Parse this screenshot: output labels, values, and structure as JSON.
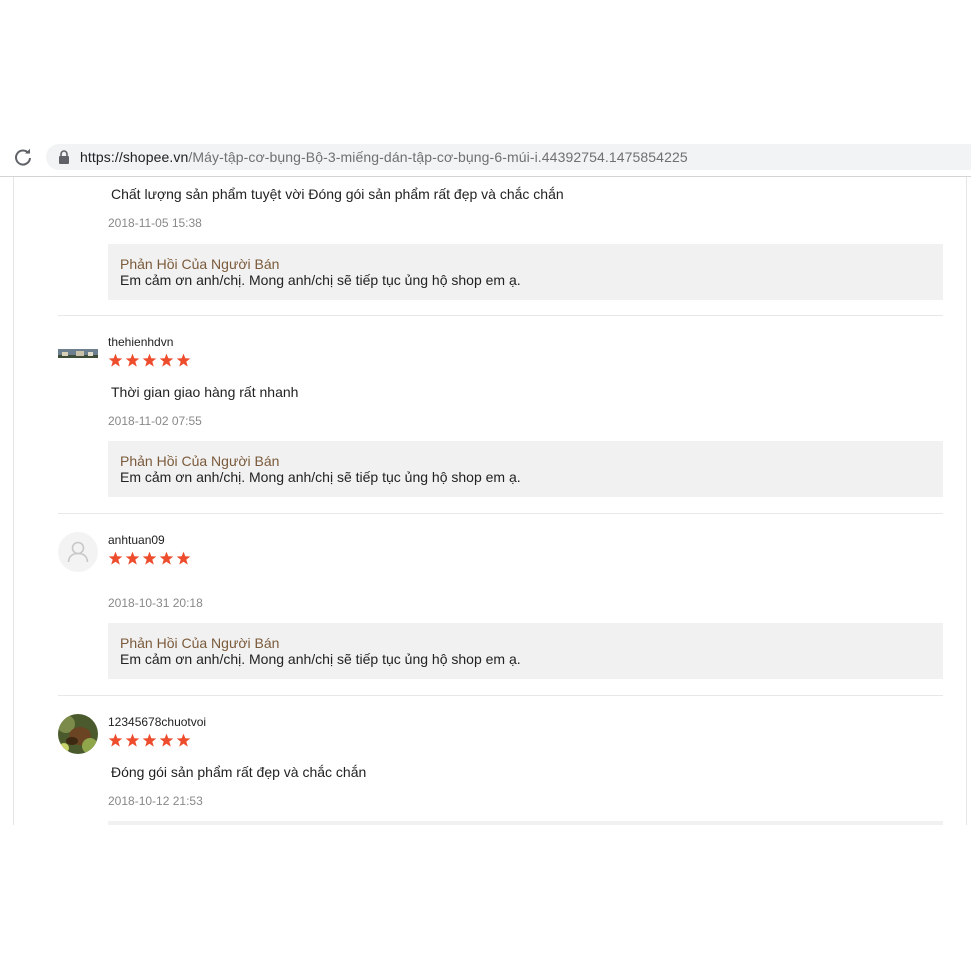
{
  "browser": {
    "url_host": "https://shopee.vn",
    "url_path": "/Máy-tập-cơ-bụng-Bộ-3-miếng-dán-tập-cơ-bụng-6-múi-i.44392754.1475854225"
  },
  "reviews": [
    {
      "comment": "Chất lượng sản phẩm tuyệt vời Đóng gói sản phẩm rất đẹp và chắc chắn",
      "time": "2018-11-05 15:38",
      "reply_title": "Phản Hồi Của Người Bán",
      "reply_text": "Em cảm ơn anh/chị. Mong anh/chị sẽ tiếp tục ủng hộ shop em ạ."
    },
    {
      "username": "thehienhdvn",
      "rating": 5,
      "comment": "Thời gian giao hàng rất nhanh",
      "time": "2018-11-02 07:55",
      "reply_title": "Phản Hồi Của Người Bán",
      "reply_text": "Em cảm ơn anh/chị. Mong anh/chị sẽ tiếp tục ủng hộ shop em ạ."
    },
    {
      "username": "anhtuan09",
      "rating": 5,
      "comment": "",
      "time": "2018-10-31 20:18",
      "reply_title": "Phản Hồi Của Người Bán",
      "reply_text": "Em cảm ơn anh/chị. Mong anh/chị sẽ tiếp tục ủng hộ shop em ạ."
    },
    {
      "username": "12345678chuotvoi",
      "rating": 5,
      "comment": "Đóng gói sản phẩm rất đẹp và chắc chắn",
      "time": "2018-10-12 21:53"
    }
  ],
  "colors": {
    "star": "#ee4d2d",
    "reply_bg": "#f1f1f1",
    "reply_title": "#7a5a3a"
  },
  "icons": {
    "reload": "reload-icon",
    "lock": "lock-icon",
    "star": "star-icon",
    "default_avatar": "user-icon"
  }
}
